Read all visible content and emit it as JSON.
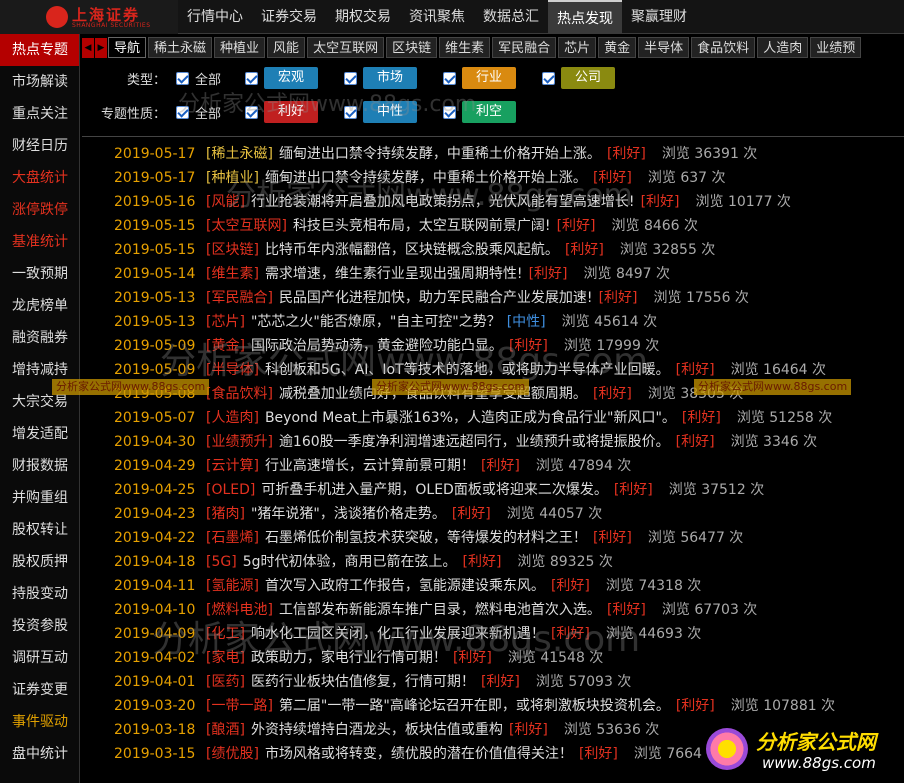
{
  "logo": {
    "text": "上海证券",
    "sub": "SHANGHAI SECURITIES"
  },
  "topnav": [
    "行情中心",
    "证券交易",
    "期权交易",
    "资讯聚焦",
    "数据总汇",
    "热点发现",
    "聚赢理财"
  ],
  "topnav_active": 5,
  "sidebar": [
    {
      "label": "热点专题",
      "style": "active"
    },
    {
      "label": "市场解读",
      "style": ""
    },
    {
      "label": "重点关注",
      "style": ""
    },
    {
      "label": "财经日历",
      "style": ""
    },
    {
      "label": "大盘统计",
      "style": "red"
    },
    {
      "label": "涨停跌停",
      "style": "red"
    },
    {
      "label": "基准统计",
      "style": "red"
    },
    {
      "label": "一致预期",
      "style": ""
    },
    {
      "label": "龙虎榜单",
      "style": ""
    },
    {
      "label": "融资融券",
      "style": ""
    },
    {
      "label": "增持减持",
      "style": ""
    },
    {
      "label": "大宗交易",
      "style": ""
    },
    {
      "label": "增发适配",
      "style": ""
    },
    {
      "label": "财报数据",
      "style": ""
    },
    {
      "label": "并购重组",
      "style": ""
    },
    {
      "label": "股权转让",
      "style": ""
    },
    {
      "label": "股权质押",
      "style": ""
    },
    {
      "label": "持股变动",
      "style": ""
    },
    {
      "label": "投资参股",
      "style": ""
    },
    {
      "label": "调研互动",
      "style": ""
    },
    {
      "label": "证券变更",
      "style": ""
    },
    {
      "label": "事件驱动",
      "style": "orange"
    },
    {
      "label": "盘中统计",
      "style": ""
    }
  ],
  "tabs": [
    "导航",
    "稀土永磁",
    "种植业",
    "风能",
    "太空互联网",
    "区块链",
    "维生素",
    "军民融合",
    "芯片",
    "黄金",
    "半导体",
    "食品饮料",
    "人造肉",
    "业绩预"
  ],
  "filters": {
    "type_label": "类型：",
    "type_all": "全部",
    "type_chips": [
      {
        "label": "宏观",
        "color": "#1e7fb5"
      },
      {
        "label": "市场",
        "color": "#1e7fb5"
      },
      {
        "label": "行业",
        "color": "#d98a10"
      },
      {
        "label": "公司",
        "color": "#8a8a10"
      }
    ],
    "nature_label": "专题性质：",
    "nature_all": "全部",
    "nature_chips": [
      {
        "label": "利好",
        "color": "#c02020"
      },
      {
        "label": "中性",
        "color": "#1e7fb5"
      },
      {
        "label": "利空",
        "color": "#18a060"
      }
    ]
  },
  "rows": [
    {
      "date": "2019-05-17",
      "tag": "[稀土永磁]",
      "tagStyle": "y",
      "title": "缅甸进出口禁令持续发酵，中重稀土价格开始上涨。",
      "nature": "[利好]",
      "nStyle": "good",
      "views": "浏览 36391 次"
    },
    {
      "date": "2019-05-17",
      "tag": "[种植业]",
      "tagStyle": "y",
      "title": "缅甸进出口禁令持续发酵，中重稀土价格开始上涨。",
      "nature": "[利好]",
      "nStyle": "good",
      "views": "浏览 637 次"
    },
    {
      "date": "2019-05-16",
      "tag": "[风能]",
      "tagStyle": "",
      "title": "行业抢装潮将开启叠加风电政策拐点，光伏风能有望高速增长!",
      "nature": "[利好]",
      "nStyle": "good",
      "views": "浏览 10177 次"
    },
    {
      "date": "2019-05-15",
      "tag": "[太空互联网]",
      "tagStyle": "",
      "title": "科技巨头竞相布局，太空互联网前景广阔!",
      "nature": "[利好]",
      "nStyle": "good",
      "views": "浏览 8466 次"
    },
    {
      "date": "2019-05-15",
      "tag": "[区块链]",
      "tagStyle": "",
      "title": "比特币年内涨幅翻倍，区块链概念股乘风起航。",
      "nature": "[利好]",
      "nStyle": "good",
      "views": "浏览 32855 次"
    },
    {
      "date": "2019-05-14",
      "tag": "[维生素]",
      "tagStyle": "",
      "title": "需求增速，维生素行业呈现出强周期特性!",
      "nature": "[利好]",
      "nStyle": "good",
      "views": "浏览 8497 次"
    },
    {
      "date": "2019-05-13",
      "tag": "[军民融合]",
      "tagStyle": "",
      "title": "民品国产化进程加快，助力军民融合产业发展加速!",
      "nature": "[利好]",
      "nStyle": "good",
      "views": "浏览 17556 次"
    },
    {
      "date": "2019-05-13",
      "tag": "[芯片]",
      "tagStyle": "",
      "title": "\"芯芯之火\"能否燎原，\"自主可控\"之势？",
      "nature": "[中性]",
      "nStyle": "neutral",
      "views": "浏览 45614 次"
    },
    {
      "date": "2019-05-09",
      "tag": "[黄金]",
      "tagStyle": "",
      "title": "国际政治局势动荡，黄金避险功能凸显。",
      "nature": "[利好]",
      "nStyle": "good",
      "views": "浏览 17999 次"
    },
    {
      "date": "2019-05-09",
      "tag": "[半导体]",
      "tagStyle": "",
      "title": "科创板和5G、AI、IoT等技术的落地，或将助力半导体产业回暖。",
      "nature": "[利好]",
      "nStyle": "good",
      "views": "浏览 16464 次"
    },
    {
      "date": "2019-05-08",
      "tag": "[食品饮料]",
      "tagStyle": "",
      "title": "减税叠加业绩向好，食品饮料有望享受超额周期。",
      "nature": "[利好]",
      "nStyle": "good",
      "views": "浏览 38305 次"
    },
    {
      "date": "2019-05-07",
      "tag": "[人造肉]",
      "tagStyle": "",
      "title": "Beyond Meat上市暴涨163%，人造肉正成为食品行业\"新风口\"。",
      "nature": "[利好]",
      "nStyle": "good",
      "views": "浏览 51258 次"
    },
    {
      "date": "2019-04-30",
      "tag": "[业绩预升]",
      "tagStyle": "",
      "title": "逾160股一季度净利润增速远超同行，业绩预升或将提振股价。",
      "nature": "[利好]",
      "nStyle": "good",
      "views": "浏览 3346 次"
    },
    {
      "date": "2019-04-29",
      "tag": "[云计算]",
      "tagStyle": "",
      "title": "行业高速增长，云计算前景可期！",
      "nature": "[利好]",
      "nStyle": "good",
      "views": "浏览 47894 次"
    },
    {
      "date": "2019-04-25",
      "tag": "[OLED]",
      "tagStyle": "",
      "title": "可折叠手机进入量产期，OLED面板或将迎来二次爆发。",
      "nature": "[利好]",
      "nStyle": "good",
      "views": "浏览 37512 次"
    },
    {
      "date": "2019-04-23",
      "tag": "[猪肉]",
      "tagStyle": "",
      "title": "\"猪年说猪\"，浅谈猪价格走势。",
      "nature": "[利好]",
      "nStyle": "good",
      "views": "浏览 44057 次"
    },
    {
      "date": "2019-04-22",
      "tag": "[石墨烯]",
      "tagStyle": "",
      "title": "石墨烯低价制氢技术获突破，等待爆发的材料之王！",
      "nature": "[利好]",
      "nStyle": "good",
      "views": "浏览 56477 次"
    },
    {
      "date": "2019-04-18",
      "tag": "[5G]",
      "tagStyle": "",
      "title": "5g时代初体验，商用已箭在弦上。",
      "nature": "[利好]",
      "nStyle": "good",
      "views": "浏览 89325 次"
    },
    {
      "date": "2019-04-11",
      "tag": "[氢能源]",
      "tagStyle": "",
      "title": "首次写入政府工作报告，氢能源建设乘东风。",
      "nature": "[利好]",
      "nStyle": "good",
      "views": "浏览 74318 次"
    },
    {
      "date": "2019-04-10",
      "tag": "[燃料电池]",
      "tagStyle": "",
      "title": "工信部发布新能源车推广目录，燃料电池首次入选。",
      "nature": "[利好]",
      "nStyle": "good",
      "views": "浏览 67703 次"
    },
    {
      "date": "2019-04-09",
      "tag": "[化工]",
      "tagStyle": "",
      "title": "响水化工园区关闭，化工行业发展迎来新机遇！",
      "nature": "[利好]",
      "nStyle": "good",
      "views": "浏览 44693 次"
    },
    {
      "date": "2019-04-02",
      "tag": "[家电]",
      "tagStyle": "",
      "title": "政策助力，家电行业行情可期！",
      "nature": "[利好]",
      "nStyle": "good",
      "views": "浏览 41548 次"
    },
    {
      "date": "2019-04-01",
      "tag": "[医药]",
      "tagStyle": "",
      "title": "医药行业板块估值修复，行情可期！",
      "nature": "[利好]",
      "nStyle": "good",
      "views": "浏览 57093 次"
    },
    {
      "date": "2019-03-20",
      "tag": "[一带一路]",
      "tagStyle": "",
      "title": "第二届\"一带一路\"高峰论坛召开在即，或将刺激板块投资机会。",
      "nature": "[利好]",
      "nStyle": "good",
      "views": "浏览 107881 次"
    },
    {
      "date": "2019-03-18",
      "tag": "[酿酒]",
      "tagStyle": "",
      "title": "外资持续增持白酒龙头，板块估值或重构",
      "nature": "[利好]",
      "nStyle": "good",
      "views": "浏览 53636 次"
    },
    {
      "date": "2019-03-15",
      "tag": "[绩优股]",
      "tagStyle": "",
      "title": "市场风格或将转变，绩优股的潜在价值值得关注！",
      "nature": "[利好]",
      "nStyle": "good",
      "views": "浏览 7664"
    }
  ],
  "watermark": {
    "line": "分析家公式网www.88gs.com",
    "strip": "分析家公式网www.88gs.com",
    "badge_title": "分析家公式网",
    "badge_url": "www.88gs.com"
  }
}
